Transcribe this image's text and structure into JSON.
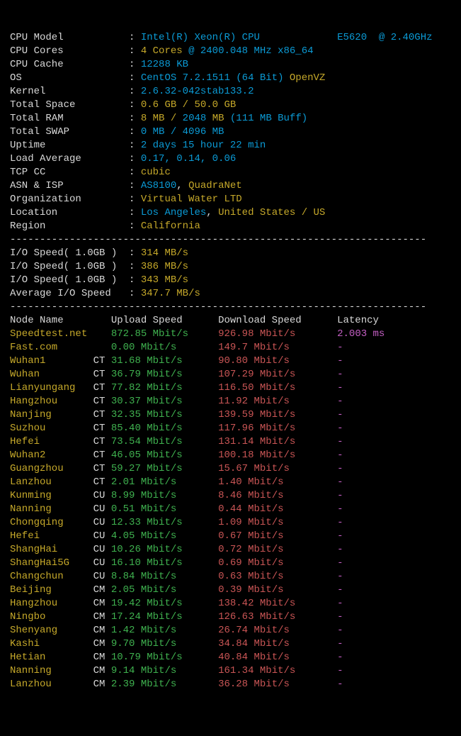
{
  "sys": {
    "labels": {
      "cpu_model": "CPU Model",
      "cpu_cores": "CPU Cores",
      "cpu_cache": "CPU Cache",
      "os": "OS",
      "kernel": "Kernel",
      "total_space": "Total Space",
      "total_ram": "Total RAM",
      "total_swap": "Total SWAP",
      "uptime": "Uptime",
      "load_avg": "Load Average",
      "tcp_cc": "TCP CC",
      "asn_isp": "ASN & ISP",
      "org": "Organization",
      "location": "Location",
      "region": "Region"
    },
    "cpu_model_a": "Intel(R) Xeon(R) CPU",
    "cpu_model_b": "E5620  @ 2.40GHz",
    "cpu_cores_a": "4 Cores",
    "cpu_cores_b": "@ 2400.048 MHz x86_64",
    "cpu_cache": "12288 KB",
    "os_a": "CentOS 7.2.1511 (64 Bit)",
    "os_b": "OpenVZ",
    "kernel": "2.6.32-042stab133.2",
    "total_space": "0.6 GB / 50.0 GB",
    "total_ram_a": "8 MB /",
    "total_ram_b": "2048",
    "total_ram_c": "MB",
    "total_ram_d": "(111 MB Buff)",
    "total_swap": "0 MB / 4096 MB",
    "uptime": "2 days 15 hour 22 min",
    "load_avg": "0.17, 0.14, 0.06",
    "tcp_cc": "cubic",
    "asn_isp_a": "AS8100",
    "asn_isp_sep": ",",
    "asn_isp_b": "QuadraNet",
    "org": "Virtual Water LTD",
    "location_a": "Los Angeles",
    "location_sep": ",",
    "location_b": "United States / US",
    "region": "California"
  },
  "io": {
    "labels": {
      "speed": "I/O Speed( 1.0GB )",
      "avg": "Average I/O Speed"
    },
    "run1": "314 MB/s",
    "run2": "386 MB/s",
    "run3": "343 MB/s",
    "avg": "347.7 MB/s"
  },
  "speed": {
    "header": {
      "node": "Node Name",
      "up": "Upload Speed",
      "down": "Download Speed",
      "lat": "Latency"
    },
    "rows": [
      {
        "name": "Speedtest.net",
        "tag": "",
        "up": "872.85 Mbit/s",
        "down": "926.98 Mbit/s",
        "lat": "2.003 ms"
      },
      {
        "name": "Fast.com",
        "tag": "",
        "up": "0.00 Mbit/s",
        "down": "149.7 Mbit/s",
        "lat": "-"
      },
      {
        "name": "Wuhan1",
        "tag": "CT",
        "up": "31.68 Mbit/s",
        "down": "90.80 Mbit/s",
        "lat": "-"
      },
      {
        "name": "Wuhan",
        "tag": "CT",
        "up": "36.79 Mbit/s",
        "down": "107.29 Mbit/s",
        "lat": "-"
      },
      {
        "name": "Lianyungang",
        "tag": "CT",
        "up": "77.82 Mbit/s",
        "down": "116.50 Mbit/s",
        "lat": "-"
      },
      {
        "name": "Hangzhou",
        "tag": "CT",
        "up": "30.37 Mbit/s",
        "down": "11.92 Mbit/s",
        "lat": "-"
      },
      {
        "name": "Nanjing",
        "tag": "CT",
        "up": "32.35 Mbit/s",
        "down": "139.59 Mbit/s",
        "lat": "-"
      },
      {
        "name": "Suzhou",
        "tag": "CT",
        "up": "85.40 Mbit/s",
        "down": "117.96 Mbit/s",
        "lat": "-"
      },
      {
        "name": "Hefei",
        "tag": "CT",
        "up": "73.54 Mbit/s",
        "down": "131.14 Mbit/s",
        "lat": "-"
      },
      {
        "name": "Wuhan2",
        "tag": "CT",
        "up": "46.05 Mbit/s",
        "down": "100.18 Mbit/s",
        "lat": "-"
      },
      {
        "name": "Guangzhou",
        "tag": "CT",
        "up": "59.27 Mbit/s",
        "down": "15.67 Mbit/s",
        "lat": "-"
      },
      {
        "name": "Lanzhou",
        "tag": "CT",
        "up": "2.01 Mbit/s",
        "down": "1.40 Mbit/s",
        "lat": "-"
      },
      {
        "name": "Kunming",
        "tag": "CU",
        "up": "8.99 Mbit/s",
        "down": "8.46 Mbit/s",
        "lat": "-"
      },
      {
        "name": "Nanning",
        "tag": "CU",
        "up": "0.51 Mbit/s",
        "down": "0.44 Mbit/s",
        "lat": "-"
      },
      {
        "name": "Chongqing",
        "tag": "CU",
        "up": "12.33 Mbit/s",
        "down": "1.09 Mbit/s",
        "lat": "-"
      },
      {
        "name": "Hefei",
        "tag": "CU",
        "up": "4.05 Mbit/s",
        "down": "0.67 Mbit/s",
        "lat": "-"
      },
      {
        "name": "ShangHai",
        "tag": "CU",
        "up": "10.26 Mbit/s",
        "down": "0.72 Mbit/s",
        "lat": "-"
      },
      {
        "name": "ShangHai5G",
        "tag": "CU",
        "up": "16.10 Mbit/s",
        "down": "0.69 Mbit/s",
        "lat": "-"
      },
      {
        "name": "Changchun",
        "tag": "CU",
        "up": "8.84 Mbit/s",
        "down": "0.63 Mbit/s",
        "lat": "-"
      },
      {
        "name": "Beijing",
        "tag": "CM",
        "up": "2.05 Mbit/s",
        "down": "0.39 Mbit/s",
        "lat": "-"
      },
      {
        "name": "Hangzhou",
        "tag": "CM",
        "up": "19.42 Mbit/s",
        "down": "138.42 Mbit/s",
        "lat": "-"
      },
      {
        "name": "Ningbo",
        "tag": "CM",
        "up": "17.24 Mbit/s",
        "down": "126.63 Mbit/s",
        "lat": "-"
      },
      {
        "name": "Shenyang",
        "tag": "CM",
        "up": "1.42 Mbit/s",
        "down": "26.74 Mbit/s",
        "lat": "-"
      },
      {
        "name": "Kashi",
        "tag": "CM",
        "up": "9.70 Mbit/s",
        "down": "34.84 Mbit/s",
        "lat": "-"
      },
      {
        "name": "Hetian",
        "tag": "CM",
        "up": "10.79 Mbit/s",
        "down": "40.84 Mbit/s",
        "lat": "-"
      },
      {
        "name": "Nanning",
        "tag": "CM",
        "up": "9.14 Mbit/s",
        "down": "161.34 Mbit/s",
        "lat": "-"
      },
      {
        "name": "Lanzhou",
        "tag": "CM",
        "up": "2.39 Mbit/s",
        "down": "36.28 Mbit/s",
        "lat": "-"
      }
    ]
  },
  "misc": {
    "sep_line": "----------------------------------------------------------------------",
    "colon": ":"
  }
}
